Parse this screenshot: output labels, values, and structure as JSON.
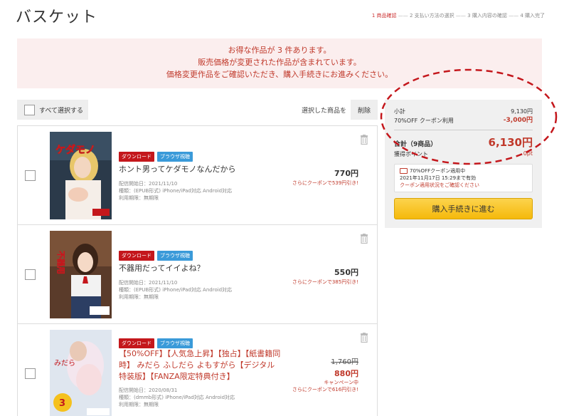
{
  "header": {
    "title": "バスケット",
    "steps": [
      {
        "label": "1 商品確認",
        "active": true
      },
      {
        "label": "2 支払い方法の選択",
        "active": false
      },
      {
        "label": "3 購入内容の確認",
        "active": false
      },
      {
        "label": "4 購入完了",
        "active": false
      }
    ],
    "separator": "——"
  },
  "notice": {
    "line1": "お得な作品が 3 件あります。",
    "line2": "販売価格が変更された作品が含まれています。",
    "line3": "価格変更作品をご確認いただき、購入手続きにお進みください。"
  },
  "toolbar": {
    "select_all": "すべて選択する",
    "selected_label": "選択した商品を",
    "delete": "削除"
  },
  "items": [
    {
      "badges": [
        "ダウンロード",
        "ブラウザ視聴"
      ],
      "title": "ホント男ってケダモノなんだから",
      "meta1": "配信開始日：2021/11/10",
      "meta2": "種類：(EPUB形式) iPhone/iPad対応 Android対応",
      "meta3": "利用期限：無期限",
      "price": "770円",
      "coupon_note": "さらにクーポンで539円引き!"
    },
    {
      "badges": [
        "ダウンロード",
        "ブラウザ視聴"
      ],
      "title": "不器用だってイイよね？",
      "meta1": "配信開始日：2021/11/10",
      "meta2": "種類：(EPUB形式) iPhone/iPad対応 Android対応",
      "meta3": "利用期限：無期限",
      "price": "550円",
      "coupon_note": "さらにクーポンで385円引き!"
    },
    {
      "badges": [
        "ダウンロード",
        "ブラウザ視聴"
      ],
      "title": "【50%OFF】【人気急上昇】【独占】【紙書籍同時】 みだら ふしだら よもすがら【デジタル特装版】【FANZA限定特典付き】",
      "meta1": "配信開始日：2020/08/31",
      "meta2": "種類：(dmmb形式) iPhone/iPad対応 Android対応",
      "meta3": "利用期限：無期限",
      "original_price": "1,760円",
      "price": "880円",
      "campaign": "キャンペーン中",
      "coupon_note": "さらにクーポンで616円引き!"
    }
  ],
  "summary": {
    "subtotal_label": "小計",
    "subtotal_value": "9,130円",
    "coupon_label": "70%OFF クーポン利用",
    "coupon_value": "-3,000円",
    "total_label": "合計（9商品）",
    "total_value": "6,130円",
    "points_label": "獲得ポイント",
    "points_value": "0pt",
    "coupon_box_line1": "70%OFFクーポン適用中",
    "coupon_box_line2": "2021年11月17日 15:29まで有効",
    "coupon_box_link": "クーポン適用状況をご確認ください",
    "buy_button": "購入手続きに進む"
  },
  "colors": {
    "accent_red": "#c0392b",
    "badge_download": "#c4171c",
    "badge_browser": "#3a9ad9",
    "buy_button": "#f5b90b",
    "notice_bg": "#fbeeee"
  }
}
